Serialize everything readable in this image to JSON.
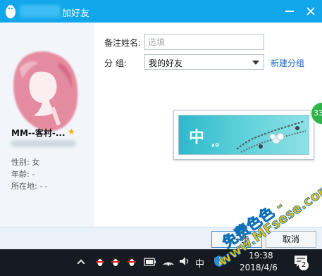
{
  "titlebar": {
    "title": "加好友"
  },
  "profile": {
    "name": "MM--客村-...",
    "star": "★",
    "gender": "性别: 女",
    "age": "年龄:  -",
    "location": "所在地:  -     -"
  },
  "form": {
    "remark_label": "备注姓名:",
    "remark_placeholder": "选填",
    "remark_value": "",
    "group_label": "分      组:",
    "group_value": "我的好友",
    "new_group_link": "新建分组"
  },
  "ime_widget": {
    "char": "中",
    "punct": ",。"
  },
  "badge": {
    "text": "33"
  },
  "buttons": {
    "next": "下一步",
    "cancel": "取消"
  },
  "taskbar": {
    "ime": "中",
    "time": "19:38",
    "date": "2018/4/6",
    "notification_count": "2"
  },
  "watermark": {
    "line1": "免费色色 -",
    "line2": "www.MFsese.com"
  },
  "colors": {
    "titlebar": "#12a7ea",
    "link": "#1f6bbf",
    "taskbar": "#161b22",
    "watermark": "#f2c300"
  },
  "icons": [
    "qq-penguin-icon",
    "minimize-icon",
    "close-icon",
    "star-icon",
    "chevron-down-icon",
    "chevron-up-icon",
    "qq-tray-icon",
    "battery-icon",
    "wifi-icon",
    "volume-icon",
    "security-shield-icon",
    "notification-icon"
  ]
}
